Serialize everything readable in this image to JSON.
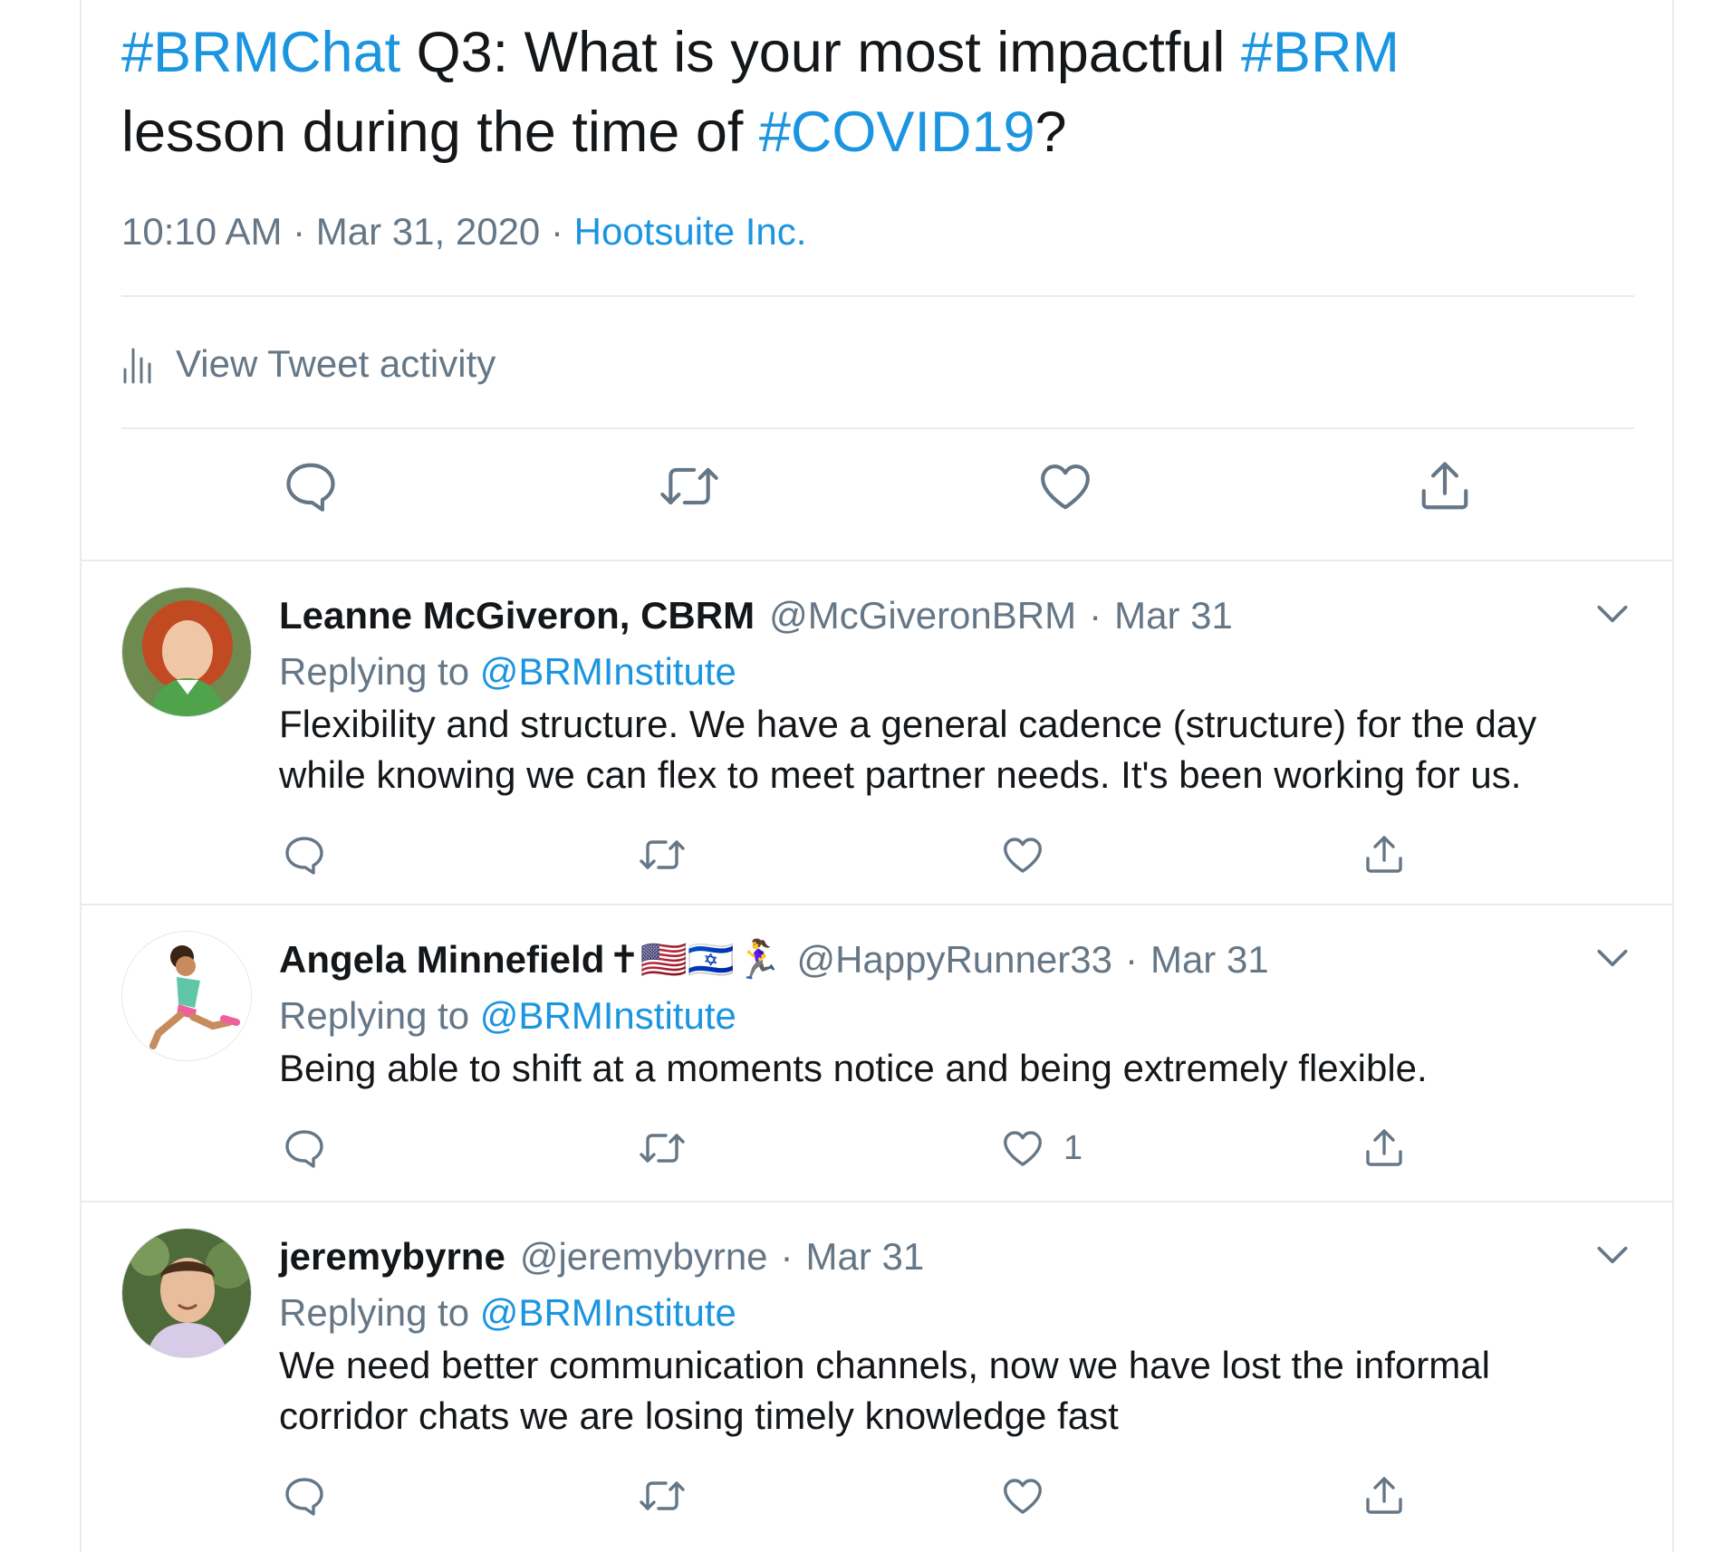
{
  "main_tweet": {
    "text_parts": {
      "hashtag1": "#BRMChat",
      "t1": " Q3: What is your most impactful ",
      "hashtag2": "#BRM",
      "t2": " lesson during the time of ",
      "hashtag3": "#COVID19",
      "t3": "?"
    },
    "time": "10:10 AM",
    "sep1": " · ",
    "date": "Mar 31, 2020",
    "sep2": " · ",
    "source": "Hootsuite Inc.",
    "activity_label": "View Tweet activity",
    "icons": [
      "bar-chart-icon",
      "reply-icon",
      "retweet-icon",
      "like-icon",
      "share-icon"
    ]
  },
  "replies": [
    {
      "name": "Leanne McGiveron, CBRM",
      "name_emojis": "",
      "handle": "@McGiveronBRM",
      "dot": "·",
      "date": "Mar 31",
      "replying_prefix": "Replying to ",
      "replying_to": "@BRMInstitute",
      "text": "Flexibility and structure.  We have a general cadence (structure) for the day while knowing we can flex to meet partner needs. It's been working for us.",
      "like_count": ""
    },
    {
      "name": "Angela Minnefield",
      "name_emojis": "✝🇺🇸🇮🇱🏃‍♀️",
      "handle": "@HappyRunner33",
      "dot": "·",
      "date": "Mar 31",
      "replying_prefix": "Replying to ",
      "replying_to": "@BRMInstitute",
      "text": "Being able to shift at a moments notice and being extremely flexible.",
      "like_count": "1"
    },
    {
      "name": "jeremybyrne",
      "name_emojis": "",
      "handle": "@jeremybyrne",
      "dot": "·",
      "date": "Mar 31",
      "replying_prefix": "Replying to ",
      "replying_to": "@BRMInstitute",
      "text": "We need better communication channels, now we have lost the informal corridor chats we are losing timely knowledge fast",
      "like_count": ""
    }
  ],
  "colors": {
    "link": "#1b95e0",
    "muted": "#657786",
    "text": "#14171a",
    "divider": "#e6ecf0"
  }
}
